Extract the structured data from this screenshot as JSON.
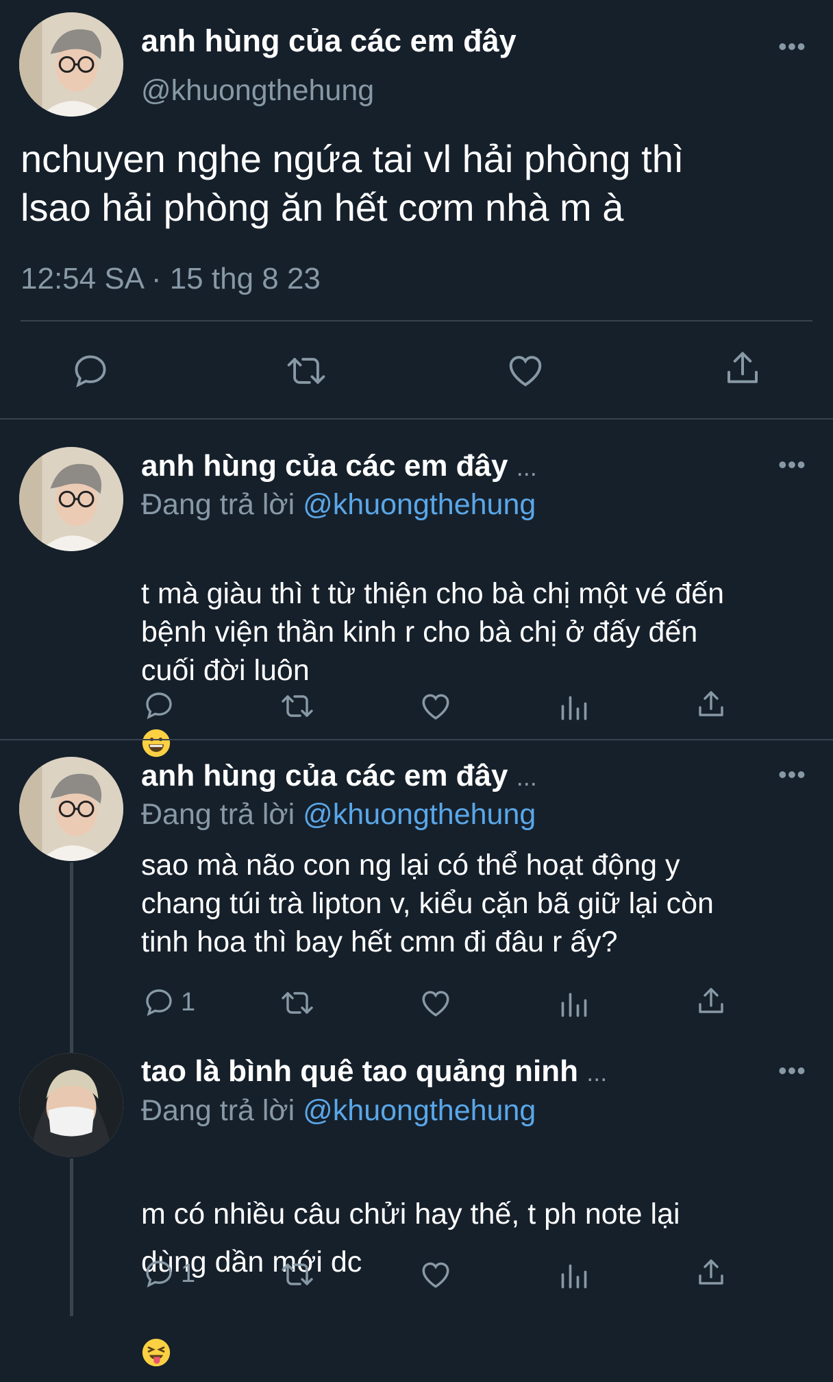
{
  "main_tweet": {
    "display_name": "anh hùng của các em đây",
    "handle": "@khuongthehung",
    "text": "nchuyen nghe ngứa tai vl hải phòng thì\nlsao hải phòng ăn hết cơm nhà m à",
    "timestamp": "12:54 SA · 15 thg 8 23"
  },
  "replies": [
    {
      "display_name": "anh hùng của các em đây",
      "ellipsis": "...",
      "replying_prefix": "Đang trả lời",
      "replying_to": "@khuongthehung",
      "text": "t mà giàu thì t từ thiện cho bà chị một vé đến\nbệnh viện thần kinh r cho bà chị ở đấy đến\ncuối đời luôn",
      "emoji": "grinning-face",
      "reply_count": ""
    },
    {
      "display_name": "anh hùng của các em đây",
      "ellipsis": "...",
      "replying_prefix": "Đang trả lời",
      "replying_to": "@khuongthehung",
      "text": "sao mà não con ng lại có thể hoạt động y\nchang túi trà lipton v, kiểu cặn bã giữ lại còn\ntinh hoa thì bay hết cmn đi đâu r ấy?",
      "reply_count": "1"
    },
    {
      "display_name": "tao là bình quê tao quảng ninh",
      "ellipsis": "...",
      "replying_prefix": "Đang trả lời",
      "replying_to": "@khuongthehung",
      "text": "m có nhiều câu chửi hay thế, t ph note lại\ndùng dần mới dc",
      "emoji": "squinting-tongue-face",
      "reply_count": "1"
    }
  ],
  "colors": {
    "background": "#16202b",
    "muted": "#8899a6",
    "link": "#5aa7e8",
    "divider": "#38444d"
  }
}
